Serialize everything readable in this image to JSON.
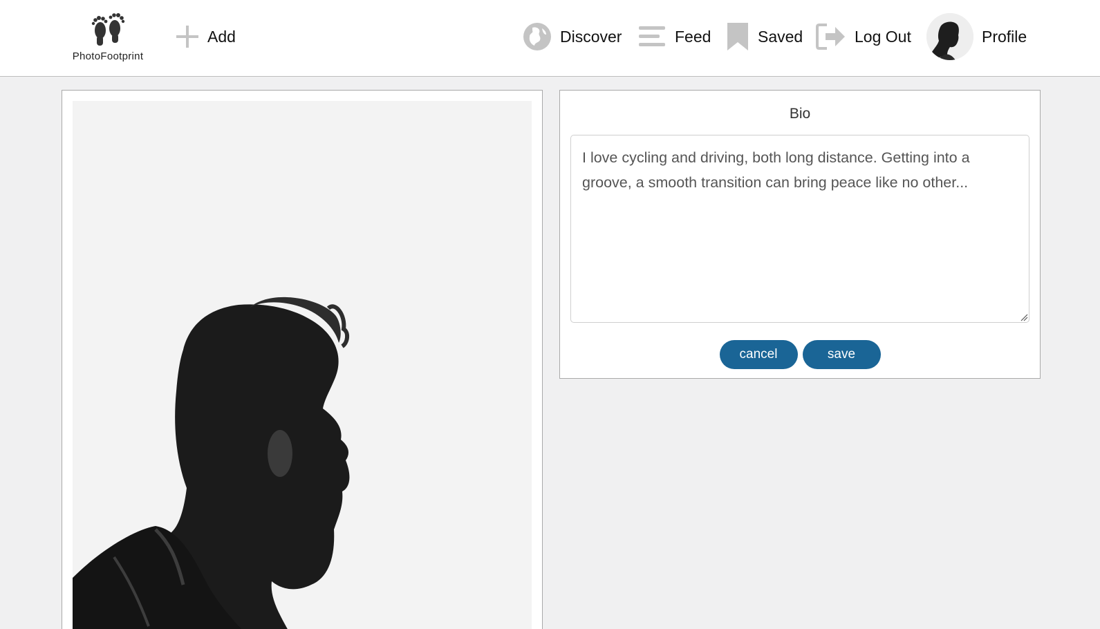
{
  "brand": {
    "name": "PhotoFootprint",
    "icon": "footprints-icon"
  },
  "nav": {
    "add": {
      "label": "Add",
      "icon": "plus-icon"
    },
    "discover": {
      "label": "Discover",
      "icon": "globe-icon"
    },
    "feed": {
      "label": "Feed",
      "icon": "menu-lines-icon"
    },
    "saved": {
      "label": "Saved",
      "icon": "bookmark-icon"
    },
    "logout": {
      "label": "Log Out",
      "icon": "logout-arrow-icon"
    },
    "profile": {
      "label": "Profile",
      "icon": "avatar"
    }
  },
  "bio": {
    "title": "Bio",
    "text": "I love cycling and driving, both long distance. Getting into a groove, a smooth transition can bring peace like no other...",
    "cancel_label": "cancel",
    "save_label": "save"
  },
  "colors": {
    "accent": "#1a6596",
    "background": "#f0f0f1",
    "icon_gray": "#c4c4c4"
  }
}
